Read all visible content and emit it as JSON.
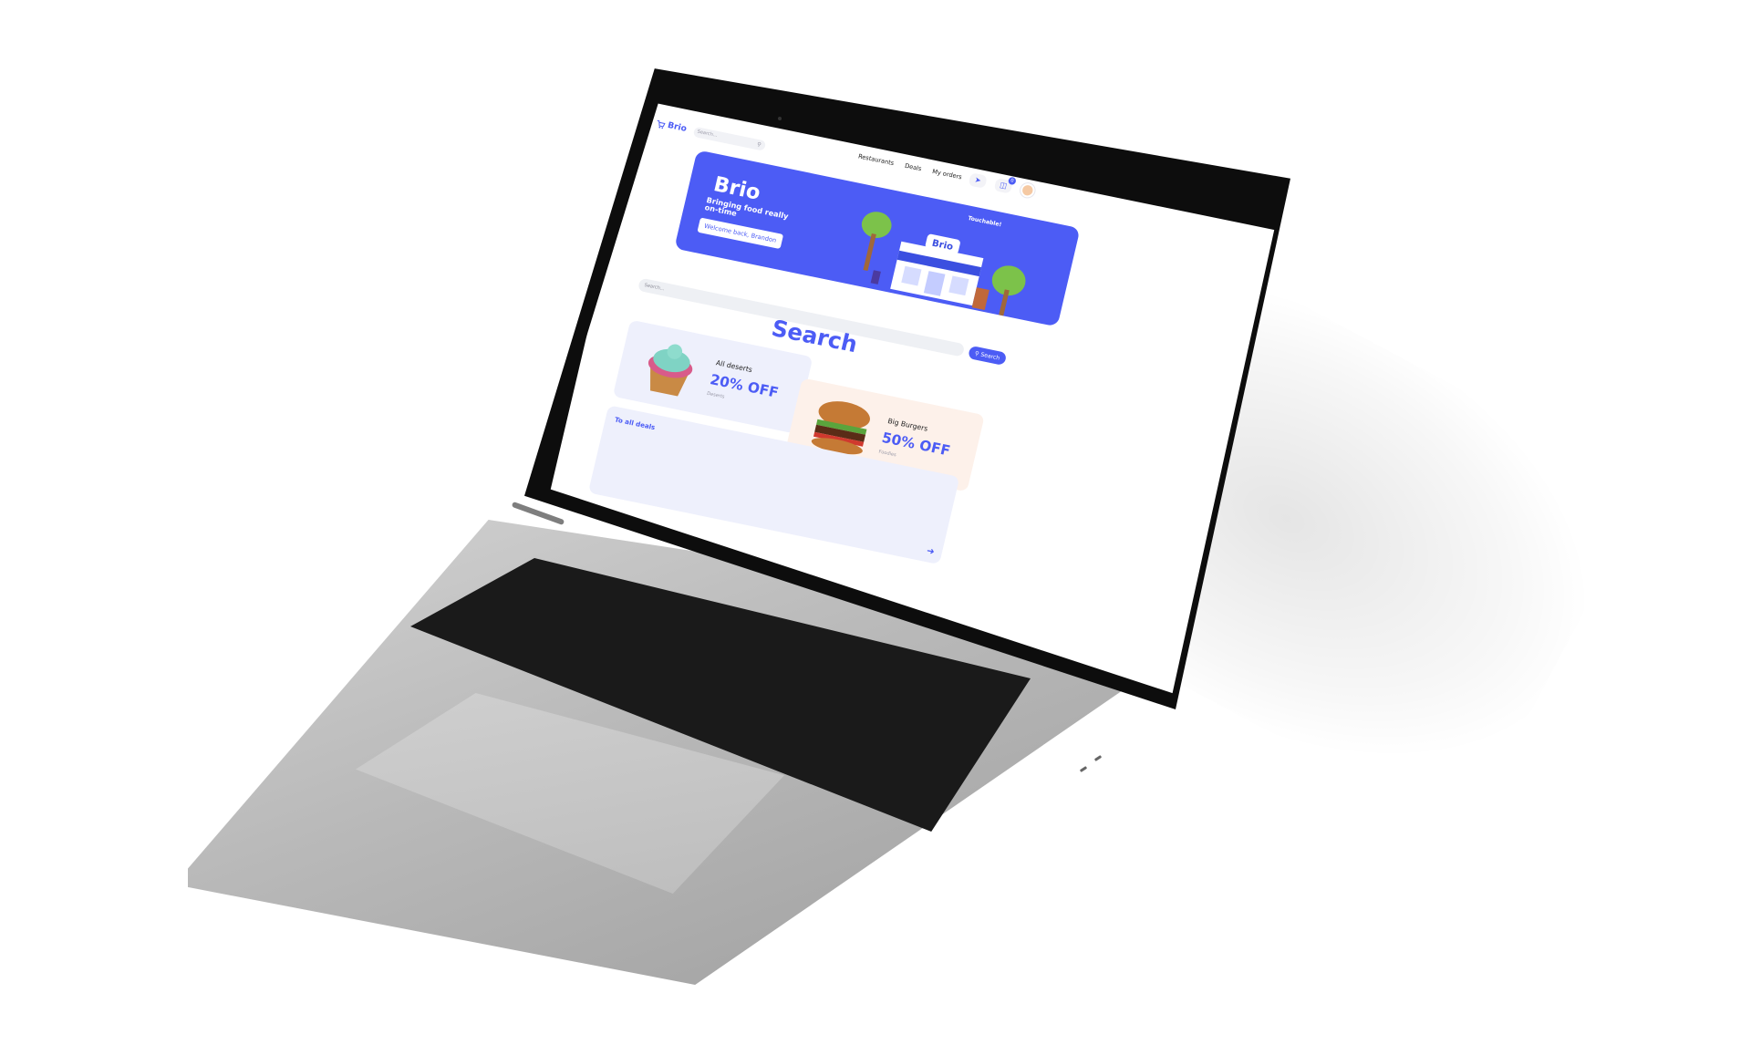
{
  "app": {
    "name": "Brio",
    "brand_color": "#4c5cf5"
  },
  "nav": {
    "logo_text": "Brio",
    "logo_icon": "cart-icon",
    "search_placeholder": "Search...",
    "links": [
      "Restaurants",
      "Deals",
      "My orders"
    ],
    "icons": [
      "send-icon",
      "bag-icon",
      "avatar"
    ],
    "cart_count": "0"
  },
  "hero": {
    "title": "Brio",
    "subtitle": "Bringing food really on-time",
    "welcome_button": "Welcome back, Brandon",
    "touchable_label": "Touchable!",
    "sign_text": "Brio"
  },
  "search": {
    "placeholder": "Search...",
    "heading": "Search",
    "button_label": "Search"
  },
  "deals": [
    {
      "name": "All deserts",
      "discount": "20% OFF",
      "category": "Deserts",
      "bg": "#eef0fc"
    },
    {
      "name": "Big Burgers",
      "discount": "50% OFF",
      "category": "Foodies",
      "bg": "#fdf1ea"
    }
  ],
  "all_deals": {
    "label": "To all deals"
  }
}
